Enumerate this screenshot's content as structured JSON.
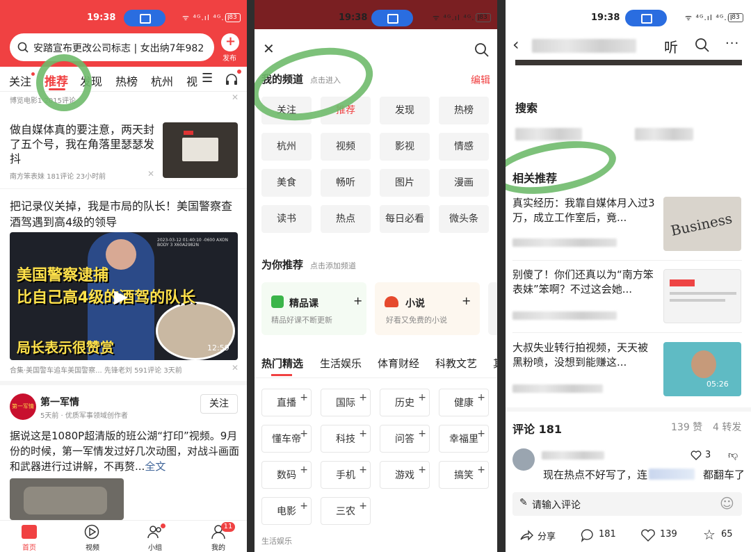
{
  "status": {
    "time": "19:38",
    "signal": "ᯤ ⁴ᴳ.ıl ⁴ᴳ.ıl",
    "battery": "83"
  },
  "left": {
    "search_text": "安踏宣布更改公司标志 | 女出纳7年982",
    "publish_label": "发布",
    "tabs": [
      "关注",
      "推荐",
      "发现",
      "热榜",
      "杭州",
      "视"
    ],
    "active_tab": "推荐",
    "top_meta": "博览电影1  2015评论",
    "articles": [
      {
        "title": "做自媒体真的要注意，两天封了五个号，我在角落里瑟瑟发抖",
        "meta": "南方笨表妹  181评论  23小时前"
      },
      {
        "title": "把记录仪关掉，我是市局的队长！美国警察查酒驾遇到高4级的领导",
        "video_line1": "美国警察逮捕",
        "video_line2": "比自己高4级的酒驾的队长",
        "video_line3": "局长表示很赞赏",
        "video_stamp": "2023-03-12 01:40:10 -0600  AXON BODY 3 X60A2982N",
        "duration": "12:59",
        "meta": "合集·美国警车追车美国警察...  先锋老刘  591评论  3天前"
      }
    ],
    "creator": {
      "name": "第一军情",
      "avatar_text": "第一军情",
      "sub": "5天前 · 优质军事领域创作者",
      "follow_label": "关注",
      "body": "据说这是1080P超清版的班公湖“打印”视频。9月份的时候，第一军情发过好几次动图，对战斗画面和武器进行过讲解，不再赘...",
      "more": "全文"
    },
    "bottom_nav": [
      {
        "label": "首页",
        "icon": "home-icon"
      },
      {
        "label": "视频",
        "icon": "video-icon"
      },
      {
        "label": "小组",
        "icon": "group-icon"
      },
      {
        "label": "我的",
        "icon": "profile-icon",
        "badge": "11"
      }
    ]
  },
  "middle": {
    "my_channels_title": "我的频道",
    "my_channels_hint": "点击进入",
    "edit_label": "编辑",
    "my_channels": [
      "关注",
      "推荐",
      "发现",
      "热榜",
      "杭州",
      "视频",
      "影视",
      "情感",
      "美食",
      "畅听",
      "图片",
      "漫画",
      "读书",
      "热点",
      "每日必看",
      "微头条"
    ],
    "recommend_title": "为你推荐",
    "recommend_hint": "点击添加频道",
    "recommend_cards": [
      {
        "title": "精品课",
        "desc": "精品好课不断更新"
      },
      {
        "title": "小说",
        "desc": "好看又免费的小说"
      }
    ],
    "category_tabs": [
      "热门精选",
      "生活娱乐",
      "体育财经",
      "科教文艺",
      "其"
    ],
    "hot_channels": [
      "直播",
      "国际",
      "历史",
      "健康",
      "懂车帝",
      "科技",
      "问答",
      "幸福里",
      "数码",
      "手机",
      "游戏",
      "搞笑",
      "电影",
      "三农"
    ],
    "section_label": "生活娱乐"
  },
  "right": {
    "listen_label": "听",
    "search_section": "搜索",
    "related_title": "相关推荐",
    "related": [
      {
        "title": "真实经历：我靠自媒体月入过3万，成立工作室后，竟..."
      },
      {
        "title": "别傻了！你们还真以为“南方笨表妹”笨啊？不过这会她..."
      },
      {
        "title": "大叔失业转行拍视频，天天被黑粉喷，没想到能赚这...",
        "duration": "05:26"
      }
    ],
    "comments_label": "评论 181",
    "likes_label": "139 赞",
    "shares_label": "4 转发",
    "comment_likes": "3",
    "comment_text_a": "现在热点不好写了，连",
    "comment_text_b": "都翻车了",
    "input_placeholder": "请输入评论",
    "actions": {
      "share": "分享",
      "comments": "181",
      "likes": "139",
      "favs": "65"
    }
  }
}
